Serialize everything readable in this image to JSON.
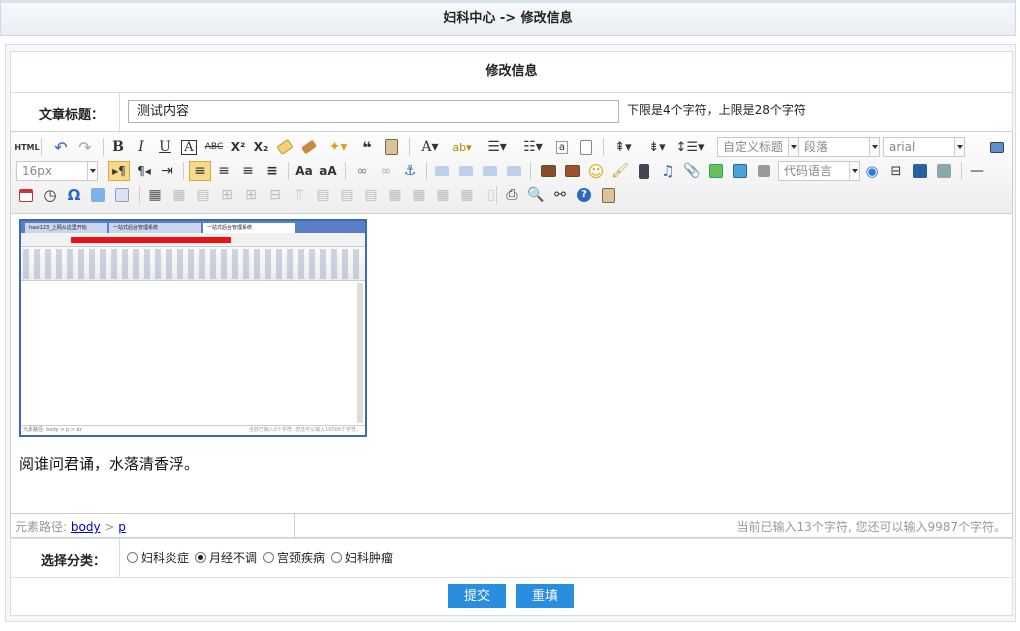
{
  "header": {
    "title": "妇科中心 -> 修改信息"
  },
  "form": {
    "title": "修改信息",
    "article_title_label": "文章标题：",
    "article_title_value": "测试内容",
    "title_hint": "下限是4个字符，上限是28个字符",
    "category_label": "选择分类：",
    "categories": [
      {
        "label": "妇科炎症",
        "selected": false
      },
      {
        "label": "月经不调",
        "selected": true
      },
      {
        "label": "宫颈疾病",
        "selected": false
      },
      {
        "label": "妇科肿瘤",
        "selected": false
      }
    ],
    "submit_label": "提交",
    "reset_label": "重填"
  },
  "editor": {
    "toolbar": {
      "html_label": "HTML",
      "bold": "B",
      "italic": "I",
      "underline": "U",
      "custom_title": "自定义标题",
      "paragraph": "段落",
      "font_family": "arial",
      "font_size": "16px",
      "code_language": "代码语言"
    },
    "content_text": "阅谁问君诵，水落清香浮。",
    "status": {
      "path_label": "元素路径:",
      "path_body": "body",
      "path_sep": ">",
      "path_p": "p",
      "char_count": "当前已输入13个字符, 您还可以输入9987个字符。"
    }
  },
  "embedded_screenshot": {
    "tabs": [
      "haoi123_上网从这里开始",
      "一站式后台管理系统",
      "一站式后台管理系统"
    ],
    "status_path": "元素路径: body > p > br",
    "status_count": "当前已输入0个字符, 您还可以输入10000个字符。"
  },
  "colors": {
    "accent": "#2a8ee0",
    "border": "#d6dde4",
    "link": "#0000cc"
  }
}
